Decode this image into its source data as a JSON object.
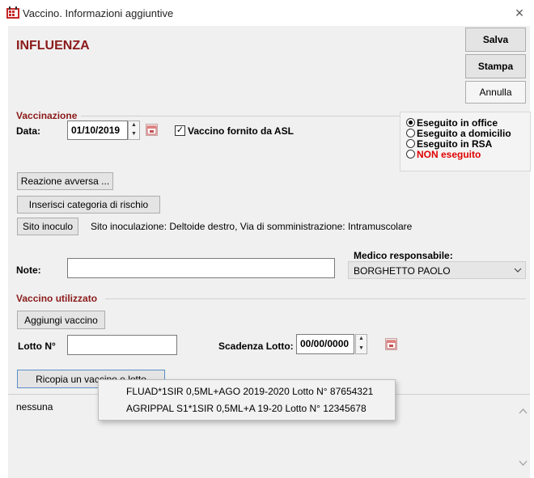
{
  "window": {
    "title": "Vaccino. Informazioni aggiuntive",
    "close_symbol": "×"
  },
  "header": {
    "vaccine_name": "INFLUENZA"
  },
  "actions": {
    "save": "Salva",
    "print": "Stampa",
    "cancel": "Annulla"
  },
  "vaccinazione": {
    "section_title": "Vaccinazione",
    "date_label": "Data:",
    "date_value": "01/10/2019",
    "asl_checkbox_label": "Vaccino fornito da ASL",
    "asl_checked": true,
    "location_options": [
      {
        "label": "Eseguito in office",
        "selected": true,
        "color": "#000000"
      },
      {
        "label": "Eseguito a domicilio",
        "selected": false,
        "color": "#000000"
      },
      {
        "label": "Eseguito in RSA",
        "selected": false,
        "color": "#000000"
      },
      {
        "label": "NON eseguito",
        "selected": false,
        "color": "#e00000"
      }
    ],
    "adverse_reaction_button": "Reazione avversa ...",
    "risk_category_button": "Inserisci categoria di rischio",
    "site_button": "Sito inoculo",
    "site_text": "Sito inoculazione: Deltoide destro, Via di somministrazione: Intramuscolare",
    "notes_label": "Note:",
    "notes_value": "",
    "doctor_label": "Medico responsabile:",
    "doctor_value": "BORGHETTO PAOLO"
  },
  "vaccino_utilizzato": {
    "section_title": "Vaccino utilizzato",
    "add_vaccine_button": "Aggiungi vaccino",
    "lot_label": "Lotto N°",
    "lot_value": "",
    "expiry_label": "Scadenza Lotto:",
    "expiry_value": "00/00/0000",
    "copy_button": "Ricopia un vaccino e lotto",
    "list_text": "nessuna"
  },
  "popup_menu": {
    "items": [
      "FLUAD*1SIR 0,5ML+AGO 2019-2020 Lotto N° 87654321",
      "AGRIPPAL S1*1SIR 0,5ML+A 19-20 Lotto N° 12345678"
    ]
  },
  "colors": {
    "heading": "#8b1a1a",
    "not_done": "#e00000",
    "client_bg": "#f0f0f0"
  }
}
